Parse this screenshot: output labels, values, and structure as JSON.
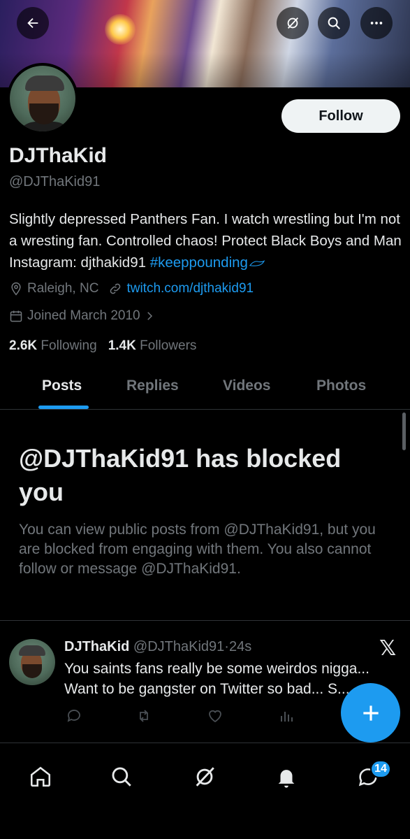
{
  "header": {
    "back_icon": "arrow-left-icon",
    "grok_icon": "grok-icon",
    "search_icon": "search-icon",
    "more_icon": "more-dots-icon"
  },
  "profile": {
    "follow_label": "Follow",
    "display_name": "DJThaKid",
    "handle": "@DJThaKid91",
    "bio_text": "Slightly depressed Panthers Fan. I watch wrestling but I'm not a wresting fan. Controlled chaos! Protect Black Boys and Man Instagram: djthakid91 ",
    "bio_hashtag": "#keeppounding",
    "location": "Raleigh, NC",
    "website": "twitch.com/djthakid91",
    "joined": "Joined March 2010",
    "following_count": "2.6K",
    "following_label": "Following",
    "followers_count": "1.4K",
    "followers_label": "Followers"
  },
  "tabs": [
    {
      "label": "Posts",
      "active": true
    },
    {
      "label": "Replies",
      "active": false
    },
    {
      "label": "Videos",
      "active": false
    },
    {
      "label": "Photos",
      "active": false
    }
  ],
  "blocked": {
    "title": "@DJThaKid91 has blocked you",
    "description": "You can view public posts from @DJThaKid91, but you are blocked from engaging with them. You also cannot follow or message @DJThaKid91."
  },
  "tweet": {
    "name": "DJThaKid",
    "handle": "@DJThaKid91",
    "separator": "·",
    "time": "24s",
    "text": "You saints fans really be some weirdos nigga... Want to be gangster on Twitter so bad... S..."
  },
  "fab_icon": "plus-icon",
  "bottom_nav": {
    "items": [
      "home-icon",
      "search-icon",
      "grok-icon",
      "bell-icon",
      "messages-icon"
    ],
    "messages_badge": "14"
  },
  "colors": {
    "accent": "#1d9bf0",
    "background": "#000000",
    "text_primary": "#e7e9ea",
    "text_secondary": "#71767b"
  }
}
